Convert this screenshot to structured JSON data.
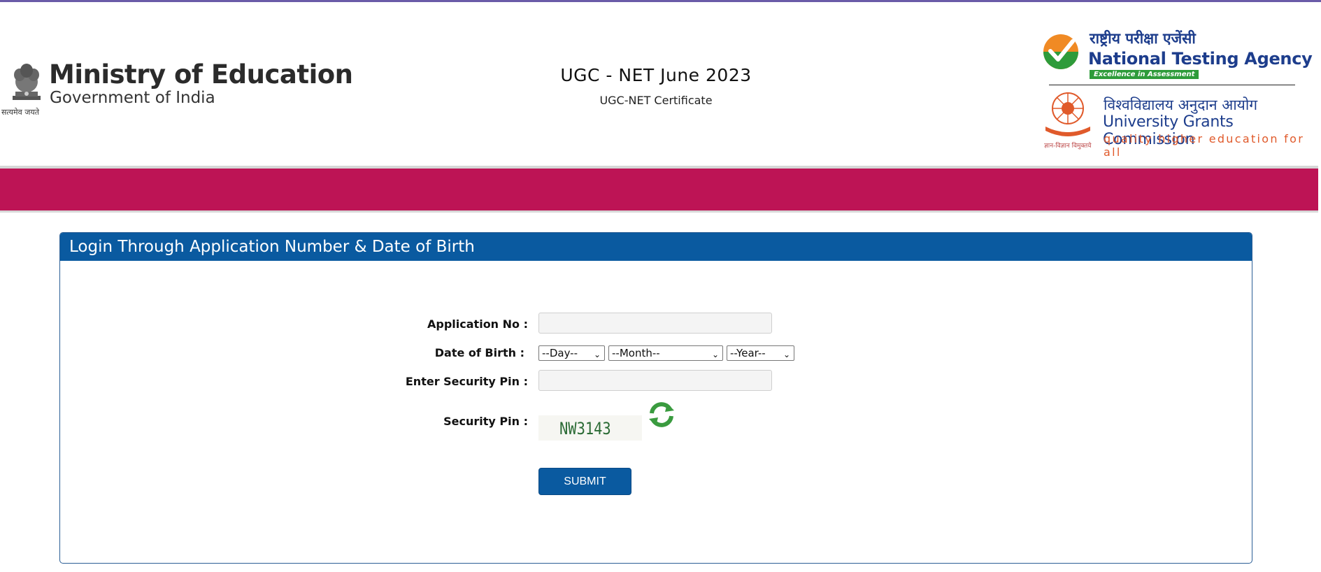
{
  "header": {
    "emblem_motto": "सत्यमेव जयते",
    "ministry_title": "Ministry of Education",
    "ministry_subtitle": "Government of India",
    "exam_title": "UGC - NET June 2023",
    "exam_subtitle": "UGC-NET Certificate",
    "nta": {
      "hindi": "राष्ट्रीय परीक्षा एजेंसी",
      "title": "National Testing Agency",
      "tagline": "Excellence in Assessment"
    },
    "ugc": {
      "hindi": "विश्वविद्यालय अनुदान आयोग",
      "title": "University Grants Commission",
      "tagline": "quality higher education for all",
      "motto": "ज्ञान-विज्ञान विमुक्तये"
    }
  },
  "colors": {
    "band": "#bd1455",
    "panel_header": "#0a5aa0",
    "submit": "#0a5aa0"
  },
  "login": {
    "heading": "Login Through Application Number & Date of Birth",
    "application_label": "Application No :",
    "application_value": "",
    "dob_label": "Date of Birth :",
    "day_selected": "--Day--",
    "month_selected": "--Month--",
    "year_selected": "--Year--",
    "security_input_label": "Enter Security Pin :",
    "security_input_value": "",
    "security_pin_label": "Security Pin :",
    "captcha_text": "NW3143",
    "refresh_icon": "refresh-icon",
    "submit_label": "SUBMIT"
  }
}
